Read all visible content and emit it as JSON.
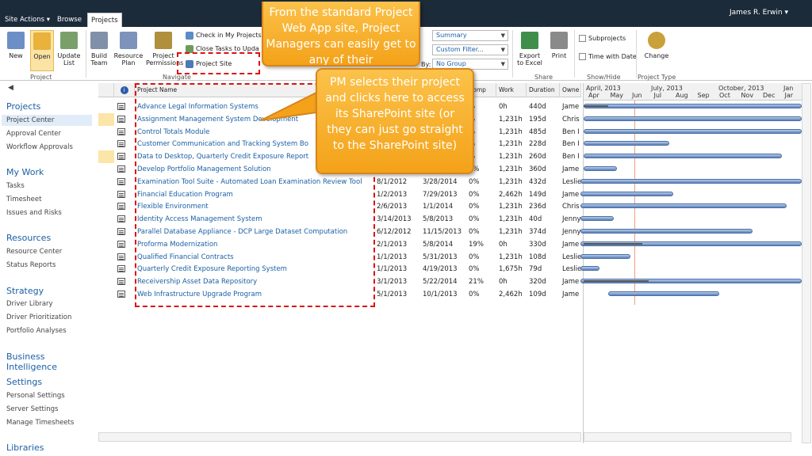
{
  "topbar": {
    "site_actions": "Site Actions ▾",
    "browse": "Browse",
    "projects": "Projects",
    "user": "James R. Erwin ▾"
  },
  "ribbon": {
    "new": "New",
    "open": "Open",
    "update_list": "Update List",
    "build_team": "Build Team",
    "resource_plan": "Resource Plan",
    "project_permissions": "Project Permissions",
    "check_in": "Check in My Projects",
    "close_tasks": "Close Tasks to Upda",
    "project_site": "Project Site",
    "group_project": "Project",
    "group_navigate": "Navigate",
    "view_summary": "Summary",
    "custom_filter": "Custom Filter...",
    "by_label": "By:",
    "no_group": "No Group",
    "export_excel": "Export to Excel",
    "print": "Print",
    "group_share": "Share",
    "subprojects": "Subprojects",
    "time_with_date": "Time with Date",
    "group_showhide": "Show/Hide",
    "change": "Change",
    "group_projecttype": "Project Type"
  },
  "leftnav": {
    "projects": "Projects",
    "project_center": "Project Center",
    "approval_center": "Approval Center",
    "workflow_approvals": "Workflow Approvals",
    "my_work": "My Work",
    "tasks": "Tasks",
    "timesheet": "Timesheet",
    "issues_risks": "Issues and Risks",
    "resources": "Resources",
    "resource_center": "Resource Center",
    "status_reports": "Status Reports",
    "strategy": "Strategy",
    "driver_library": "Driver Library",
    "driver_prioritization": "Driver Prioritization",
    "portfolio_analyses": "Portfolio Analyses",
    "business_intelligence": "Business Intelligence",
    "settings": "Settings",
    "personal_settings": "Personal Settings",
    "server_settings": "Server Settings",
    "manage_timesheets": "Manage Timesheets",
    "libraries": "Libraries"
  },
  "grid": {
    "col_name": "Project Name",
    "col_comp": "Comp",
    "col_work": "Work",
    "col_duration": "Duration",
    "col_owner": "Owne",
    "rows": [
      {
        "name": "Advance Legal Information Systems",
        "start": "",
        "finish": "",
        "comp": "%",
        "work": "0h",
        "dur": "440d",
        "owner": "Jame"
      },
      {
        "name": "Assignment Management System Development",
        "start": "",
        "finish": "",
        "comp": "%",
        "work": "1,231h",
        "dur": "195d",
        "owner": "Chris"
      },
      {
        "name": "Control Totals Module",
        "start": "",
        "finish": "",
        "comp": "%",
        "work": "1,231h",
        "dur": "485d",
        "owner": "Ben I"
      },
      {
        "name": "Customer Communication and Tracking System Bo",
        "start": "",
        "finish": "",
        "comp": "%",
        "work": "1,231h",
        "dur": "228d",
        "owner": "Ben I"
      },
      {
        "name": "Data to Desktop, Quarterly Credit Exposure Report",
        "start": "",
        "finish": "",
        "comp": "%",
        "work": "1,231h",
        "dur": "260d",
        "owner": "Ben I"
      },
      {
        "name": "Develop Portfolio Management Solution",
        "start": "",
        "finish": "",
        "comp": "0%",
        "work": "1,231h",
        "dur": "360d",
        "owner": "Jame"
      },
      {
        "name": "Examination Tool Suite - Automated Loan Examination Review Tool",
        "start": "8/1/2012",
        "finish": "3/28/2014",
        "comp": "0%",
        "work": "1,231h",
        "dur": "432d",
        "owner": "Leslie"
      },
      {
        "name": "Financial Education Program",
        "start": "1/2/2013",
        "finish": "7/29/2013",
        "comp": "0%",
        "work": "2,462h",
        "dur": "149d",
        "owner": "Jame"
      },
      {
        "name": "Flexible Environment",
        "start": "2/6/2013",
        "finish": "1/1/2014",
        "comp": "0%",
        "work": "1,231h",
        "dur": "236d",
        "owner": "Chris"
      },
      {
        "name": "Identity Access Management System",
        "start": "3/14/2013",
        "finish": "5/8/2013",
        "comp": "0%",
        "work": "1,231h",
        "dur": "40d",
        "owner": "Jenny"
      },
      {
        "name": "Parallel Database Appliance - DCP Large Dataset Computation",
        "start": "6/12/2012",
        "finish": "11/15/2013",
        "comp": "0%",
        "work": "1,231h",
        "dur": "374d",
        "owner": "Jenny"
      },
      {
        "name": "Proforma Modernization",
        "start": "2/1/2013",
        "finish": "5/8/2014",
        "comp": "19%",
        "work": "0h",
        "dur": "330d",
        "owner": "Jame"
      },
      {
        "name": "Qualified Financial Contracts",
        "start": "1/1/2013",
        "finish": "5/31/2013",
        "comp": "0%",
        "work": "1,231h",
        "dur": "108d",
        "owner": "Leslie"
      },
      {
        "name": "Quarterly Credit Exposure Reporting System",
        "start": "1/1/2013",
        "finish": "4/19/2013",
        "comp": "0%",
        "work": "1,675h",
        "dur": "79d",
        "owner": "Leslie"
      },
      {
        "name": "Receivership Asset Data Repository",
        "start": "3/1/2013",
        "finish": "5/22/2014",
        "comp": "21%",
        "work": "0h",
        "dur": "320d",
        "owner": "Jame"
      },
      {
        "name": "Web Infrastructure Upgrade Program",
        "start": "5/1/2013",
        "finish": "10/1/2013",
        "comp": "0%",
        "work": "2,462h",
        "dur": "109d",
        "owner": "Jame"
      }
    ]
  },
  "gantt": {
    "years": [
      "April, 2013",
      "July, 2013",
      "October, 2013",
      "Jan"
    ],
    "months": [
      "Apr",
      "May",
      "Jun",
      "Jul",
      "Aug",
      "Sep",
      "Oct",
      "Nov",
      "Dec",
      "Jar"
    ],
    "bars": [
      {
        "progress": 0.08
      },
      {
        "progress": 0
      },
      {
        "progress": 0
      },
      {
        "progress": 0
      },
      {
        "progress": 0
      },
      {
        "progress": 0
      },
      {
        "progress": 0
      },
      {
        "progress": 0
      },
      {
        "progress": 0
      },
      {
        "progress": 0
      },
      {
        "progress": 0
      },
      {
        "progress": 0.19
      },
      {
        "progress": 0
      },
      {
        "progress": 0
      },
      {
        "progress": 0.21
      },
      {
        "progress": 0
      }
    ]
  },
  "callouts": {
    "top": "From the standard Project Web App site, Project Managers can easily get to any of their",
    "main": "PM selects their project and clicks here to access its SharePoint site (or they can just go straight to the SharePoint site)"
  },
  "colors": {
    "topbar": "#1c2b3a",
    "link": "#1a5fa5",
    "callout": "#f4a219",
    "dash": "#dd1111"
  }
}
